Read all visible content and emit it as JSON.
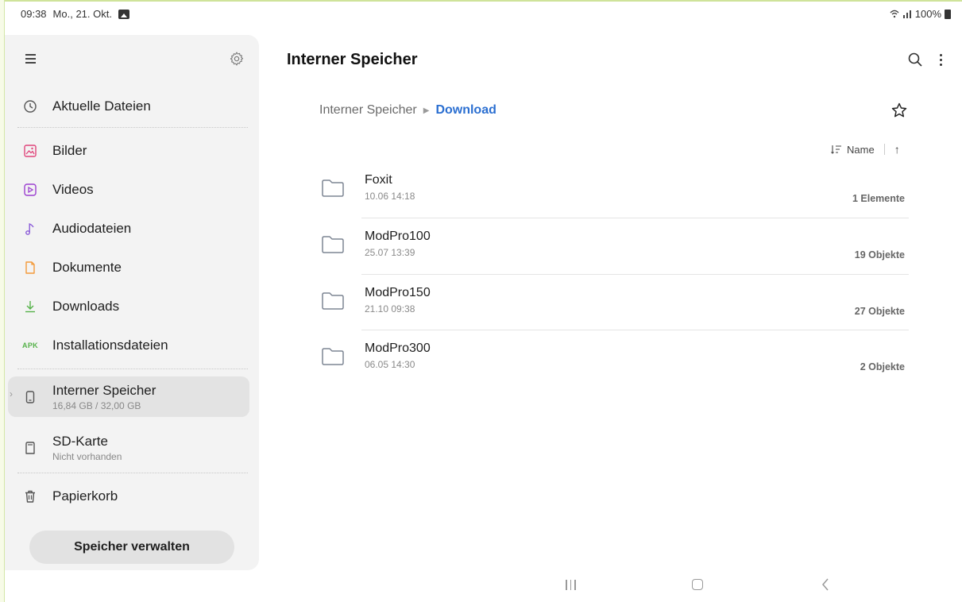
{
  "status_bar": {
    "time": "09:38",
    "date": "Mo., 21. Okt.",
    "battery": "100%"
  },
  "sidebar": {
    "items": [
      {
        "label": "Aktuelle Dateien",
        "icon": "clock-icon"
      },
      {
        "label": "Bilder",
        "icon": "image-icon"
      },
      {
        "label": "Videos",
        "icon": "video-icon"
      },
      {
        "label": "Audiodateien",
        "icon": "music-note-icon"
      },
      {
        "label": "Dokumente",
        "icon": "document-icon"
      },
      {
        "label": "Downloads",
        "icon": "download-icon"
      },
      {
        "label": "Installationsdateien",
        "icon": "apk-icon",
        "icon_text": "APK"
      }
    ],
    "storage": [
      {
        "label": "Interner Speicher",
        "sub": "16,84 GB / 32,00 GB",
        "icon": "phone-icon",
        "selected": true
      },
      {
        "label": "SD-Karte",
        "sub": "Nicht vorhanden",
        "icon": "sd-card-icon"
      }
    ],
    "trash": {
      "label": "Papierkorb",
      "icon": "trash-icon"
    },
    "manage_button": "Speicher verwalten"
  },
  "header": {
    "title": "Interner Speicher"
  },
  "breadcrumb": {
    "root": "Interner Speicher",
    "current": "Download"
  },
  "sort": {
    "label": "Name",
    "direction": "ascending"
  },
  "files": [
    {
      "name": "Foxit",
      "date": "10.06 14:18",
      "count": "1 Elemente"
    },
    {
      "name": "ModPro100",
      "date": "25.07 13:39",
      "count": "19 Objekte"
    },
    {
      "name": "ModPro150",
      "date": "21.10 09:38",
      "count": "27 Objekte"
    },
    {
      "name": "ModPro300",
      "date": "06.05 14:30",
      "count": "2 Objekte"
    }
  ],
  "colors": {
    "accent": "#2b6fd1",
    "sidebar_bg": "#f3f3f3",
    "bilder_icon": "#e0457b",
    "videos_icon": "#9b3fd0",
    "audio_icon": "#8a5ad8",
    "dokumente_icon": "#f39a3a",
    "downloads_icon": "#56b24a",
    "apk_icon": "#56b24a"
  }
}
